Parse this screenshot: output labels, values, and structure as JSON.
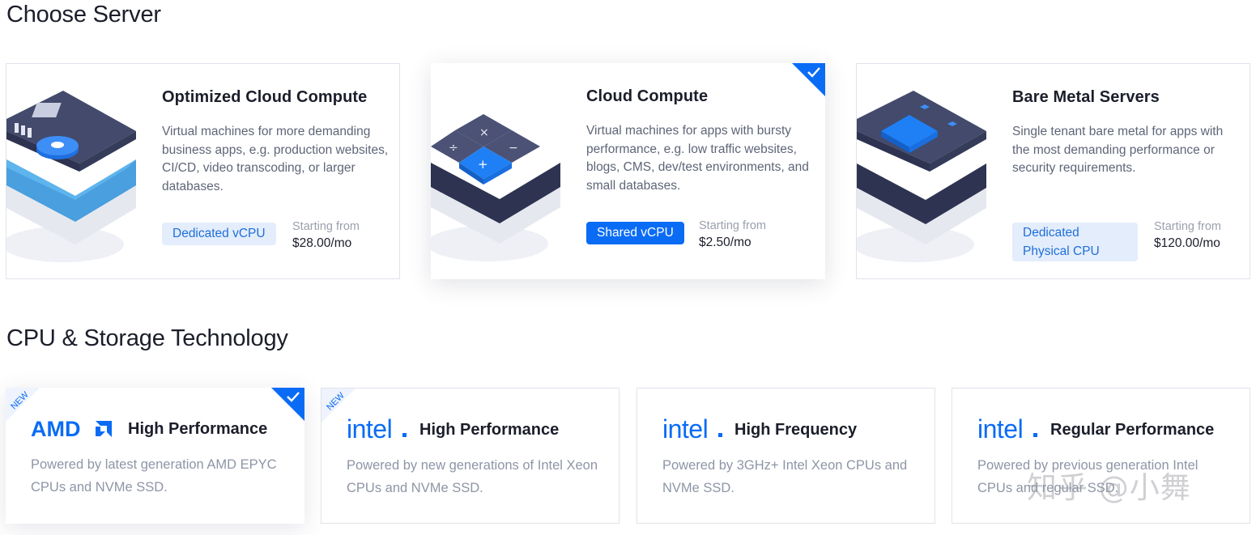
{
  "sections": {
    "server_title": "Choose Server",
    "cpu_title": "CPU & Storage Technology"
  },
  "servers": [
    {
      "name": "Optimized Cloud Compute",
      "description": "Virtual machines for more demanding business apps, e.g. production websites, CI/CD, video transcoding, or larger databases.",
      "badge": "Dedicated vCPU",
      "price_label": "Starting from",
      "price": "$28.00/mo",
      "selected": false
    },
    {
      "name": "Cloud Compute",
      "description": "Virtual machines for apps with bursty performance, e.g. low traffic websites, blogs, CMS, dev/test environments, and small databases.",
      "badge": "Shared vCPU",
      "price_label": "Starting from",
      "price": "$2.50/mo",
      "selected": true
    },
    {
      "name": "Bare Metal Servers",
      "description": "Single tenant bare metal for apps with the most demanding performance or security requirements.",
      "badge": "Dedicated Physical CPU",
      "price_label": "Starting from",
      "price": "$120.00/mo",
      "selected": false
    }
  ],
  "cpu_options": [
    {
      "brand": "AMD",
      "name": "High Performance",
      "description": "Powered by latest generation AMD EPYC CPUs and NVMe SSD.",
      "ribbon": "NEW",
      "selected": true
    },
    {
      "brand": "intel",
      "name": "High Performance",
      "description": "Powered by new generations of Intel Xeon CPUs and NVMe SSD.",
      "ribbon": "NEW",
      "selected": false
    },
    {
      "brand": "intel",
      "name": "High Frequency",
      "description": "Powered by 3GHz+ Intel Xeon CPUs and NVMe SSD.",
      "ribbon": "",
      "selected": false
    },
    {
      "brand": "intel",
      "name": "Regular Performance",
      "description": "Powered by previous generation Intel CPUs and regular SSD.",
      "ribbon": "",
      "selected": false
    }
  ],
  "watermark": "知乎 @小舞",
  "colors": {
    "accent": "#0a6cf5",
    "badge_light_bg": "#e4edfb",
    "card_border": "#dfe3ea",
    "illustration_dark": "#3b4260"
  },
  "icons": {
    "selected_marker": "check-corner-icon",
    "cpu_brand_amd": "amd-logo-icon",
    "cpu_brand_intel": "intel-logo-icon"
  }
}
